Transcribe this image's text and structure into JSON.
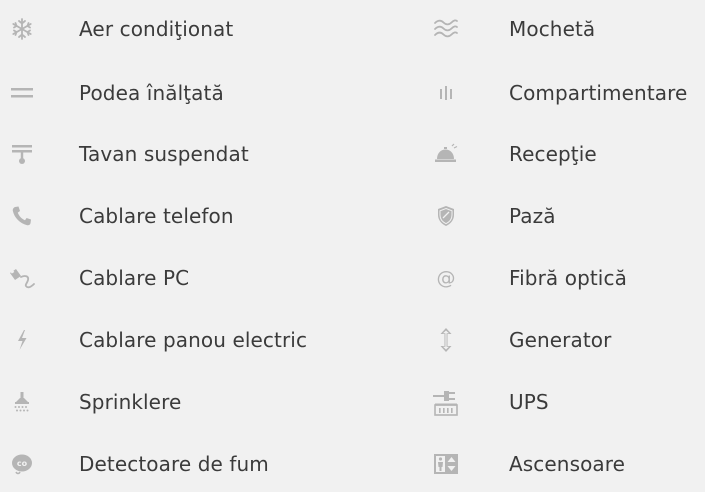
{
  "amenities": {
    "left": [
      {
        "label": "Aer condiţionat",
        "icon": "snowflake-icon"
      },
      {
        "label": "Podea înălţată",
        "icon": "raised-floor-icon"
      },
      {
        "label": "Tavan suspendat",
        "icon": "suspended-ceiling-icon"
      },
      {
        "label": "Cablare telefon",
        "icon": "phone-icon"
      },
      {
        "label": "Cablare PC",
        "icon": "network-cable-icon"
      },
      {
        "label": "Cablare panou electric",
        "icon": "lightning-icon"
      },
      {
        "label": "Sprinklere",
        "icon": "sprinkler-icon"
      },
      {
        "label": "Detectoare de fum",
        "icon": "smoke-detector-icon"
      }
    ],
    "right": [
      {
        "label": "Mochetă",
        "icon": "carpet-waves-icon"
      },
      {
        "label": "Compartimentare",
        "icon": "partition-icon"
      },
      {
        "label": "Recepţie",
        "icon": "reception-bell-icon"
      },
      {
        "label": "Pază",
        "icon": "shield-icon"
      },
      {
        "label": "Fibră optică",
        "icon": "at-sign-icon"
      },
      {
        "label": "Generator",
        "icon": "up-down-arrow-icon"
      },
      {
        "label": "UPS",
        "icon": "power-plug-icon"
      },
      {
        "label": "Ascensoare",
        "icon": "elevator-icon"
      }
    ]
  },
  "colors": {
    "background": "#f1f1f1",
    "icon": "#b5b5b5",
    "text": "#3b3b3b"
  }
}
